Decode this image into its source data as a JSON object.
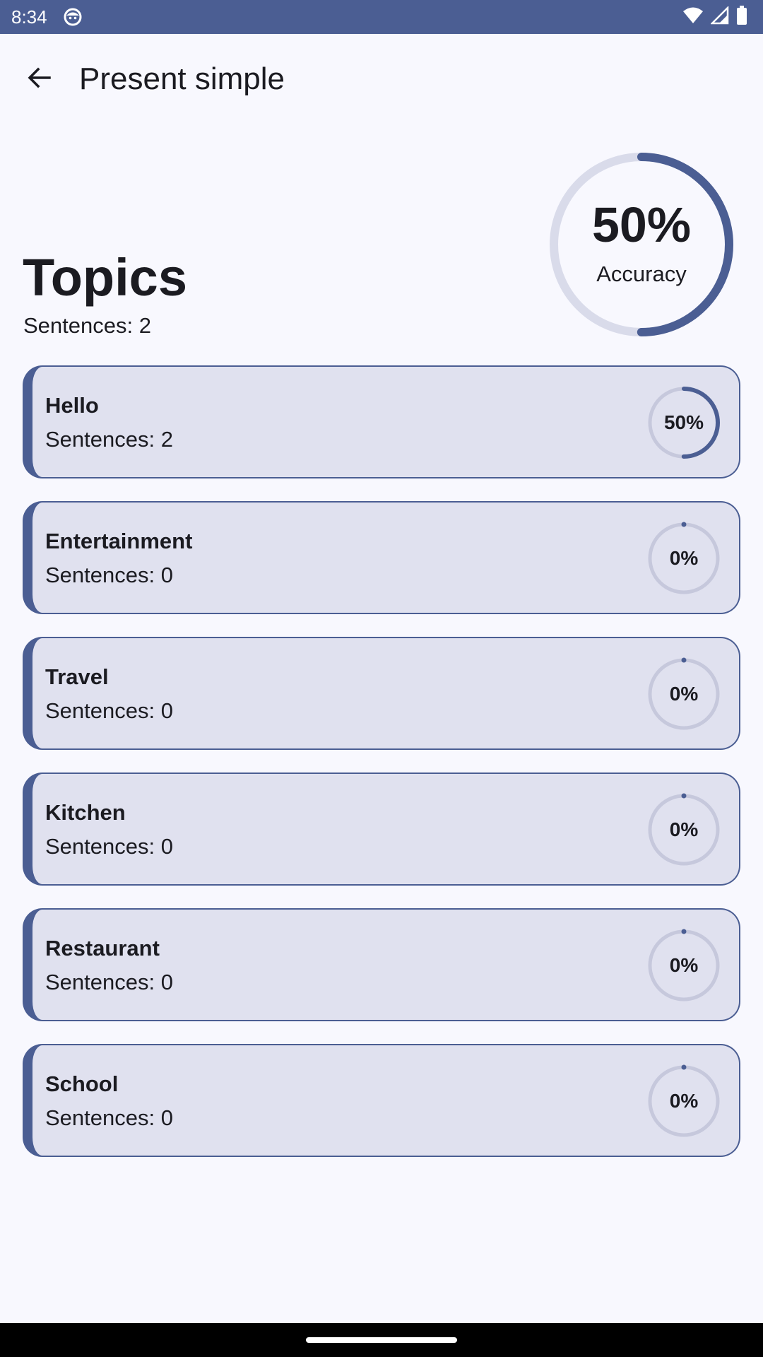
{
  "status_bar": {
    "time": "8:34",
    "app_icon": "face-icon",
    "icons": [
      "wifi-icon",
      "signal-icon",
      "battery-icon"
    ]
  },
  "app_bar": {
    "title": "Present simple",
    "back_icon": "arrow-back-icon"
  },
  "summary": {
    "title": "Topics",
    "sentences_label": "Sentences: 2",
    "accuracy_value": "50%",
    "accuracy_label": "Accuracy",
    "accuracy_fraction": 0.5
  },
  "topics": [
    {
      "name": "Hello",
      "sentences": "Sentences: 2",
      "percent": "50%",
      "fraction": 0.5
    },
    {
      "name": "Entertainment",
      "sentences": "Sentences: 0",
      "percent": "0%",
      "fraction": 0
    },
    {
      "name": "Travel",
      "sentences": "Sentences: 0",
      "percent": "0%",
      "fraction": 0
    },
    {
      "name": "Kitchen",
      "sentences": "Sentences: 0",
      "percent": "0%",
      "fraction": 0
    },
    {
      "name": "Restaurant",
      "sentences": "Sentences: 0",
      "percent": "0%",
      "fraction": 0
    },
    {
      "name": "School",
      "sentences": "Sentences: 0",
      "percent": "0%",
      "fraction": 0
    }
  ],
  "colors": {
    "accent": "#4b5e93",
    "track": "#d9dbea",
    "card_background": "#e0e1ef",
    "page_background": "#f8f8fe"
  }
}
